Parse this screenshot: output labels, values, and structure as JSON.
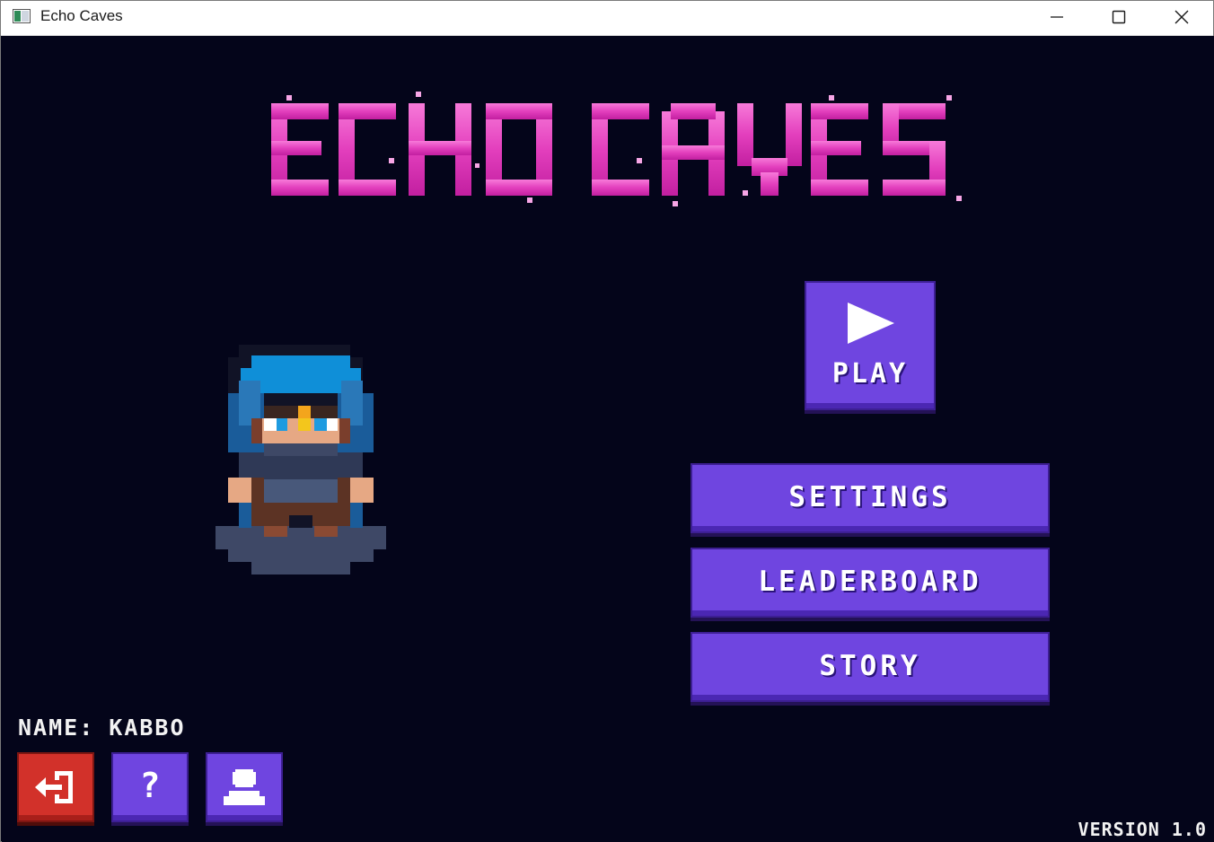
{
  "window": {
    "title": "Echo Caves",
    "controls": [
      "minimize",
      "maximize",
      "close"
    ]
  },
  "game": {
    "title": "ECHO CAVES",
    "title_color": "#e33fbd",
    "background": "#04051a"
  },
  "menu": {
    "play_label": "PLAY",
    "settings_label": "SETTINGS",
    "leaderboard_label": "LEADERBOARD",
    "story_label": "STORY",
    "button_color": "#6f45e0"
  },
  "player": {
    "name_label": "NAME:",
    "name_value": "KABBO"
  },
  "bottom_buttons": {
    "exit_icon": "exit-door-icon",
    "help_glyph": "?",
    "help_icon": "help-icon",
    "profile_icon": "user-icon",
    "exit_color": "#d2312a"
  },
  "version": "VERSION 1.0"
}
